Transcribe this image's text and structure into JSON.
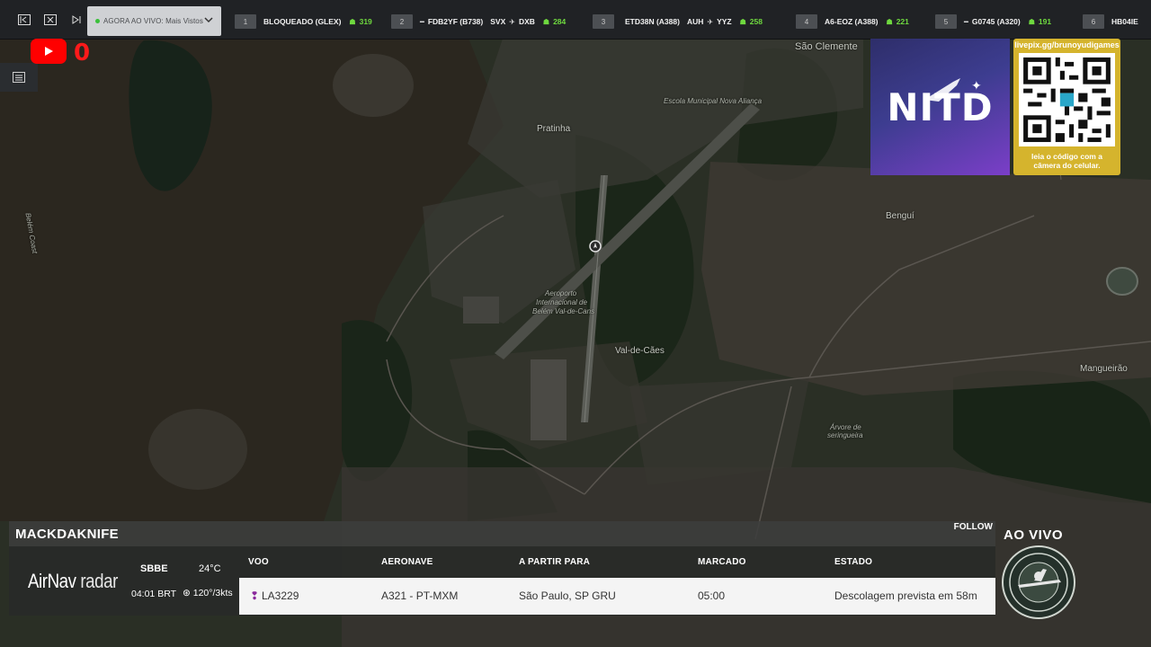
{
  "topbar": {
    "live_dropdown": "AGORA AO VIVO: Mais Vistos",
    "tickers": [
      {
        "rank": "1",
        "name": "BLOQUEADO (GLEX)",
        "route_from": "",
        "route_to": "",
        "viewers": "319"
      },
      {
        "rank": "2",
        "name": "FDB2YF (B738)",
        "route_from": "SVX",
        "route_to": "DXB",
        "viewers": "284"
      },
      {
        "rank": "3",
        "name": "ETD38N (A388)",
        "route_from": "AUH",
        "route_to": "YYZ",
        "viewers": "258"
      },
      {
        "rank": "4",
        "name": "A6-EOZ (A388)",
        "route_from": "",
        "route_to": "",
        "viewers": "221"
      },
      {
        "rank": "5",
        "name": "G0745 (A320)",
        "route_from": "",
        "route_to": "",
        "viewers": "191"
      },
      {
        "rank": "6",
        "name": "HB04IE",
        "route_from": "",
        "route_to": "",
        "viewers": ""
      }
    ]
  },
  "youtube": {
    "count": "0"
  },
  "sponsor": {
    "logo_text": "NITD",
    "qr_url": "livepix.gg/brunoyudigames",
    "qr_caption_line1": "leia o código com a",
    "qr_caption_line2": "câmera do celular."
  },
  "map_labels": {
    "sao_clemente": "São Clemente",
    "pratinha": "Pratinha",
    "benguí": "Benguí",
    "airport_line1": "Aeroporto",
    "airport_line2": "Internacional de",
    "airport_line3": "Belém Val-de-Cans",
    "val_de_caes": "Val-de-Cães",
    "mangueirao": "Mangueirão",
    "arvore": "Árvore de",
    "arvore2": "seringueira",
    "belem_coast": "Belém Coast",
    "nova_alianca": "Escola Municipal Nova Aliança"
  },
  "flight_panel": {
    "title": "MACKDAKNIFE",
    "follow": "FOLLOW",
    "brand_main": "AirNav",
    "brand_sub": "radar",
    "airport_code": "SBBE",
    "local_time": "04:01 BRT",
    "temperature": "24°C",
    "wind": "120°/3kts",
    "columns": {
      "flight": "VOO",
      "aircraft": "AERONAVE",
      "from_to": "A PARTIR PARA",
      "scheduled": "MARCADO",
      "status": "ESTADO"
    },
    "row": {
      "flight": "LA3229",
      "aircraft": "A321 - PT-MXM",
      "from_to": "São Paulo, SP GRU",
      "scheduled": "05:00",
      "status": "Descolagem prevista em 58m"
    }
  },
  "live_badge": "AO VIVO"
}
